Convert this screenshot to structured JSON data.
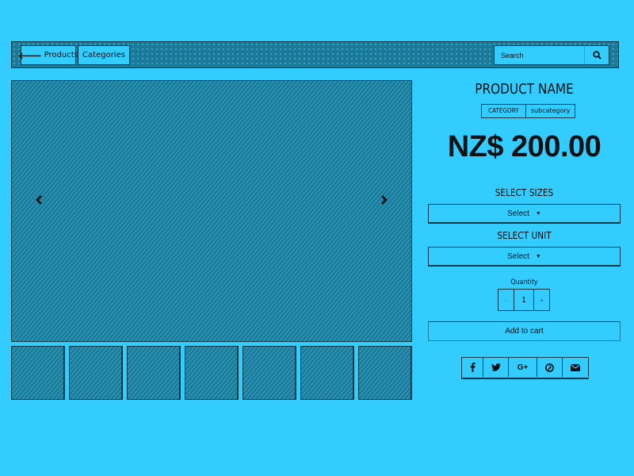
{
  "navbar": {
    "products_label": "Products",
    "categories_label": "Categories",
    "search_placeholder": "Search",
    "search_icon": "search-icon",
    "back_icon": "arrow-left-icon"
  },
  "gallery": {
    "prev_icon": "chevron-left-icon",
    "next_icon": "chevron-right-icon",
    "thumbnail_count": 7
  },
  "product": {
    "name": "PRODUCT NAME",
    "category": "CATEGORY",
    "subcategory": "subcategory",
    "price": "NZ$ 200.00",
    "sizes_label": "SELECT SIZES",
    "sizes_value": "Select",
    "unit_label": "SELECT UNIT",
    "unit_value": "Select",
    "quantity_label": "Quantity",
    "quantity_minus": "-",
    "quantity_value": "1",
    "quantity_plus": "+",
    "add_to_cart": "Add to cart"
  },
  "share": [
    {
      "name": "facebook",
      "icon": "facebook-icon"
    },
    {
      "name": "twitter",
      "icon": "twitter-icon"
    },
    {
      "name": "google-plus",
      "icon": "google-plus-icon",
      "text": "G+"
    },
    {
      "name": "pinterest",
      "icon": "pinterest-icon"
    },
    {
      "name": "email",
      "icon": "envelope-icon"
    }
  ],
  "colors": {
    "background": "#33ccff",
    "dark_pattern": "#1d7b97",
    "border": "#0d3b4a"
  }
}
